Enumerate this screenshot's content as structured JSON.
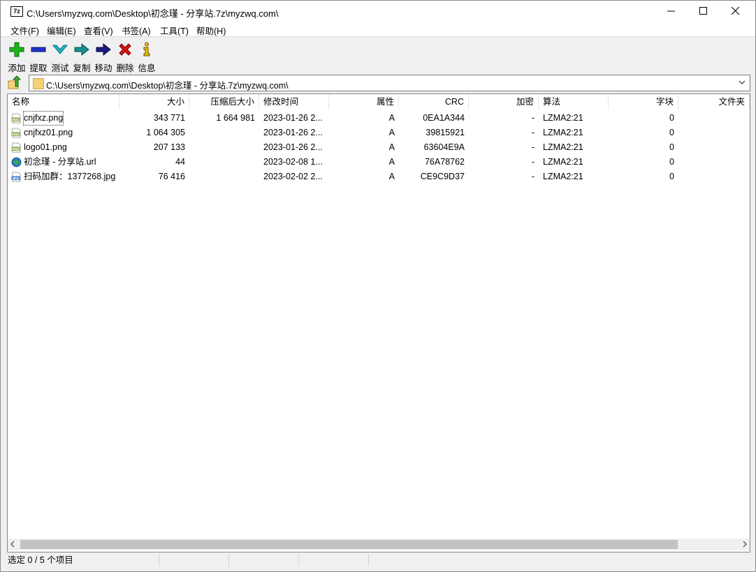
{
  "window": {
    "title": "C:\\Users\\myzwq.com\\Desktop\\初念瑾 - 分享站.7z\\myzwq.com\\",
    "app_icon_text": "7z"
  },
  "menu": [
    {
      "label": "文件(F)"
    },
    {
      "label": "编辑(E)"
    },
    {
      "label": "查看(V)"
    },
    {
      "label": "书签(A)"
    },
    {
      "label": "工具(T)"
    },
    {
      "label": "帮助(H)"
    }
  ],
  "toolbar": [
    {
      "label": "添加",
      "icon": "add-icon",
      "color": "#1db31d"
    },
    {
      "label": "提取",
      "icon": "extract-icon",
      "color": "#2233cc"
    },
    {
      "label": "测试",
      "icon": "test-icon",
      "color": "#1fb5c9"
    },
    {
      "label": "复制",
      "icon": "copy-icon",
      "color": "#1a8f8f"
    },
    {
      "label": "移动",
      "icon": "move-icon",
      "color": "#1a1a80"
    },
    {
      "label": "删除",
      "icon": "delete-icon",
      "color": "#dd1111"
    },
    {
      "label": "信息",
      "icon": "info-icon",
      "color": "#c9a400"
    }
  ],
  "address": {
    "path": "C:\\Users\\myzwq.com\\Desktop\\初念瑾 - 分享站.7z\\myzwq.com\\"
  },
  "columns": [
    "名称",
    "大小",
    "压缩后大小",
    "修改时间",
    "属性",
    "CRC",
    "加密",
    "算法",
    "字块",
    "文件夹"
  ],
  "files": [
    {
      "name": "cnjfxz.png",
      "icon": "png-file-icon",
      "size": "343 771",
      "packed": "1 664 981",
      "modified": "2023-01-26 2...",
      "attr": "A",
      "crc": "0EA1A344",
      "encrypted": "-",
      "method": "LZMA2:21",
      "block": "0"
    },
    {
      "name": "cnjfxz01.png",
      "icon": "png-file-icon",
      "size": "1 064 305",
      "packed": "",
      "modified": "2023-01-26 2...",
      "attr": "A",
      "crc": "39815921",
      "encrypted": "-",
      "method": "LZMA2:21",
      "block": "0"
    },
    {
      "name": "logo01.png",
      "icon": "png-file-icon",
      "size": "207 133",
      "packed": "",
      "modified": "2023-01-26 2...",
      "attr": "A",
      "crc": "63604E9A",
      "encrypted": "-",
      "method": "LZMA2:21",
      "block": "0"
    },
    {
      "name": "初念瑾 - 分享站.url",
      "icon": "url-globe-icon",
      "size": "44",
      "packed": "",
      "modified": "2023-02-08 1...",
      "attr": "A",
      "crc": "76A78762",
      "encrypted": "-",
      "method": "LZMA2:21",
      "block": "0"
    },
    {
      "name": "扫码加群：1377268.jpg",
      "icon": "jpg-file-icon",
      "size": "76 416",
      "packed": "",
      "modified": "2023-02-02 2...",
      "attr": "A",
      "crc": "CE9C9D37",
      "encrypted": "-",
      "method": "LZMA2:21",
      "block": "0"
    }
  ],
  "status": {
    "selection": "选定 0 / 5 个项目",
    "cell2": "",
    "cell3": "",
    "cell4": ""
  }
}
